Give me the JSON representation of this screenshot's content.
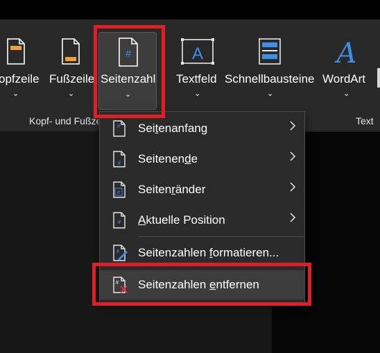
{
  "ribbon": {
    "buttons": [
      {
        "id": "kopfzeile",
        "label": "Kopfzeile",
        "visible_label": "opfzeile",
        "chevron": "⌄"
      },
      {
        "id": "fusszeile",
        "label": "Fußzeile",
        "chevron": "⌄"
      },
      {
        "id": "seitenzahl",
        "label": "Seitenzahl",
        "chevron": "⌄",
        "active": true
      },
      {
        "id": "textfeld",
        "label": "Textfeld",
        "chevron": "⌄"
      },
      {
        "id": "schnellbausteine",
        "label": "Schnellbausteine",
        "chevron": "⌄"
      },
      {
        "id": "wordart",
        "label": "WordArt",
        "chevron": "⌄"
      }
    ],
    "groups": {
      "kopf": "Kopf- und Fußzeile",
      "text": "Text"
    }
  },
  "icons": {
    "page_number_glyph": "#",
    "textfeld_glyph": "A",
    "wordart_glyph": "A"
  },
  "menu": {
    "items": [
      {
        "pre": "Sei",
        "ul": "t",
        "post": "enanfang",
        "submenu": true
      },
      {
        "pre": "Seitenen",
        "ul": "d",
        "post": "e",
        "submenu": true
      },
      {
        "pre": "Seiten",
        "ul": "r",
        "post": "änder",
        "submenu": true
      },
      {
        "pre": "",
        "ul": "A",
        "post": "ktuelle Position",
        "submenu": true
      },
      {
        "pre": "Seitenzahlen ",
        "ul": "f",
        "post": "ormatieren...",
        "submenu": false
      },
      {
        "pre": "Seitenzahlen ",
        "ul": "e",
        "post": "ntfernen",
        "submenu": false,
        "highlighted": true
      }
    ]
  },
  "colors": {
    "ribbon_bg": "#292929",
    "menu_bg": "#2b2b2b",
    "accent_blue": "#3d8ee6",
    "accent_orange": "#f0a030",
    "highlight_red": "#e01e26",
    "remove_red": "#e0303a"
  }
}
